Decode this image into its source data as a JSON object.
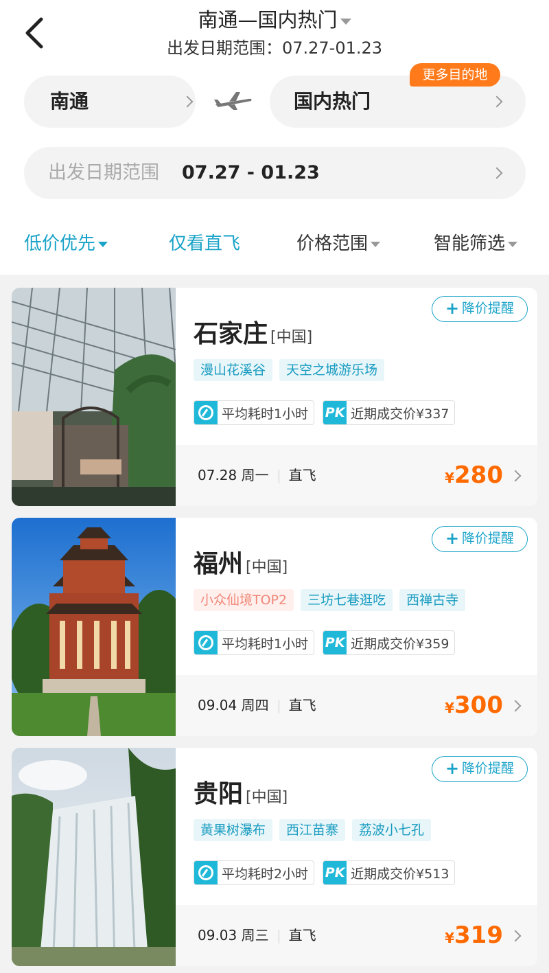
{
  "header": {
    "title": "南通—国内热门",
    "subtitle": "出发日期范围：07.27-01.23"
  },
  "route": {
    "from": "南通",
    "to": "国内热门",
    "more_badge": "更多目的地"
  },
  "date_range": {
    "label": "出发日期范围",
    "value": "07.27 - 01.23"
  },
  "filters": [
    {
      "label": "低价优先",
      "active": true
    },
    {
      "label": "仅看直飞"
    },
    {
      "label": "价格范围"
    },
    {
      "label": "智能筛选"
    }
  ],
  "alert_label": "降价提醒",
  "cards": [
    {
      "city": "石家庄",
      "country": "[中国]",
      "tags": [
        "漫山花溪谷",
        "天空之城游乐场"
      ],
      "duration": "平均耗时1小时",
      "recent_price": "近期成交价¥337",
      "date": "07.28 周一",
      "flight": "直飞",
      "currency": "¥",
      "price": "280"
    },
    {
      "city": "福州",
      "country": "[中国]",
      "tags": [
        "小众仙境TOP2",
        "三坊七巷逛吃",
        "西禅古寺"
      ],
      "duration": "平均耗时1小时",
      "recent_price": "近期成交价¥359",
      "date": "09.04 周四",
      "flight": "直飞",
      "currency": "¥",
      "price": "300"
    },
    {
      "city": "贵阳",
      "country": "[中国]",
      "tags": [
        "黄果树瀑布",
        "西江苗寨",
        "荔波小七孔"
      ],
      "duration": "平均耗时2小时",
      "recent_price": "近期成交价¥513",
      "date": "09.03 周三",
      "flight": "直飞",
      "currency": "¥",
      "price": "319"
    }
  ],
  "colors": {
    "accent": "#1aa3c8",
    "price": "#ff6a00",
    "badge": "#ff7a1a"
  }
}
